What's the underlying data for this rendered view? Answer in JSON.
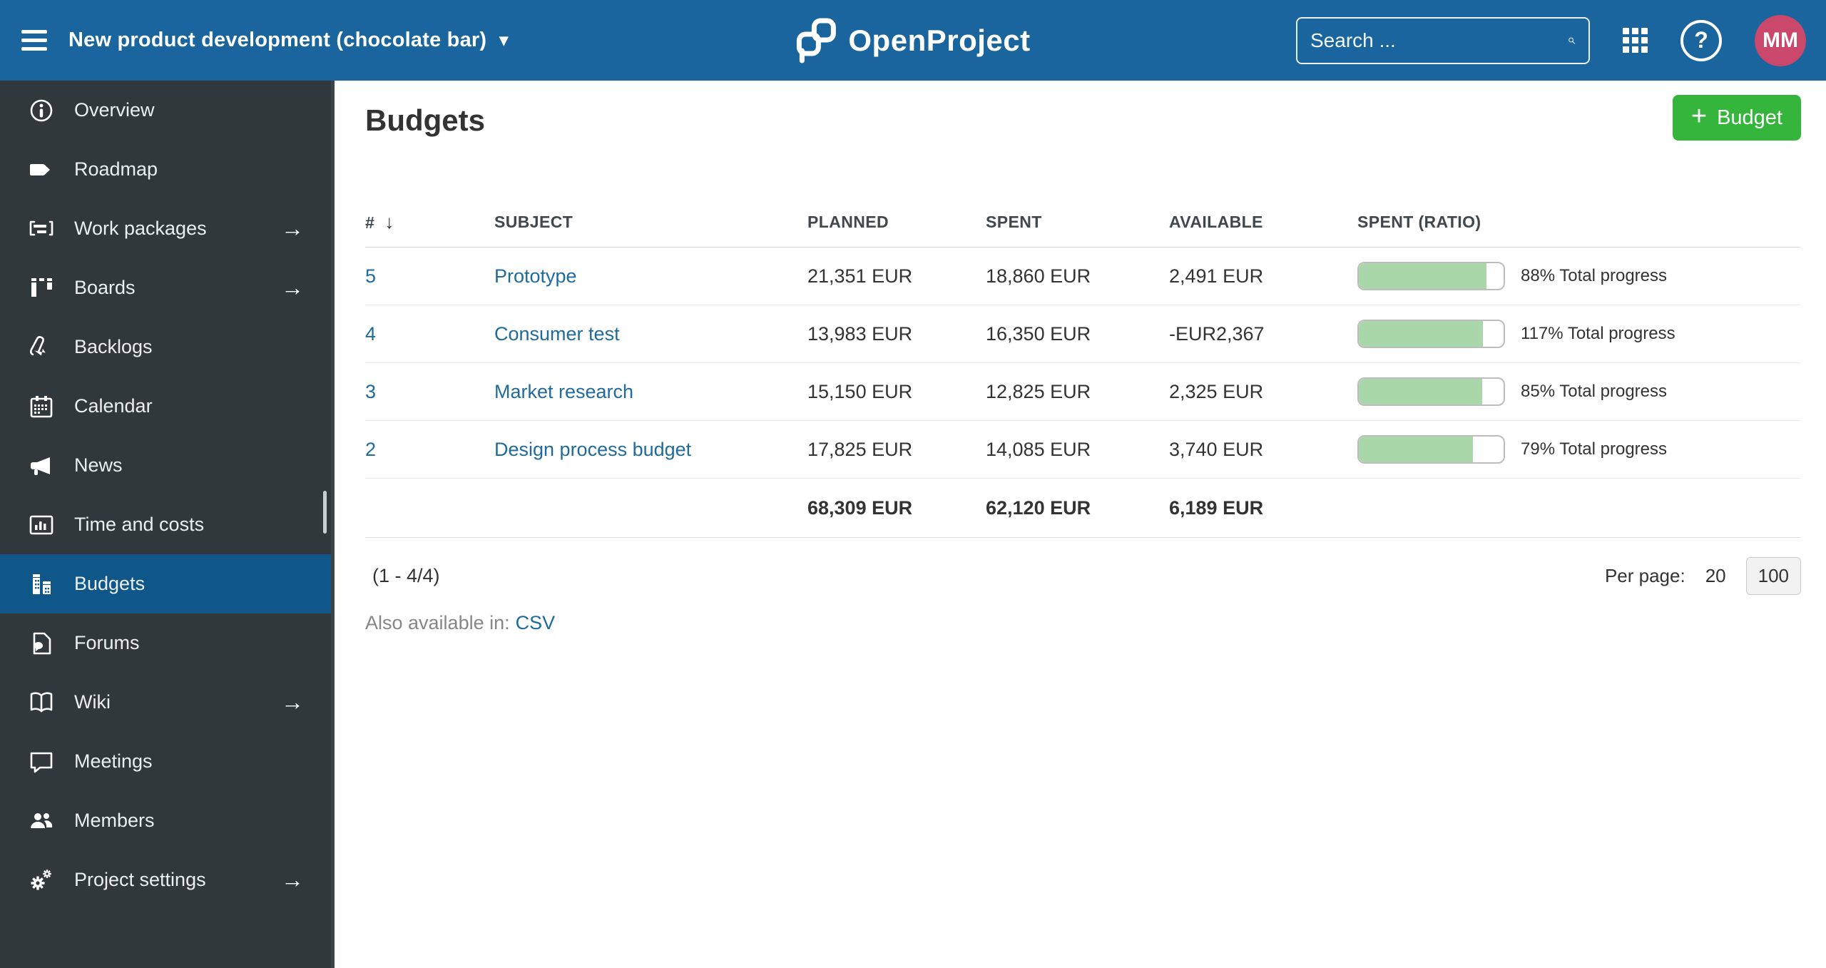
{
  "header": {
    "project_name": "New product development (chocolate bar)",
    "logo_text": "OpenProject",
    "search_placeholder": "Search ...",
    "avatar_initials": "MM"
  },
  "sidebar": {
    "items": [
      {
        "label": "Overview",
        "icon": "info-icon"
      },
      {
        "label": "Roadmap",
        "icon": "tag-icon"
      },
      {
        "label": "Work packages",
        "icon": "view-list-icon",
        "arrow": "→"
      },
      {
        "label": "Boards",
        "icon": "kanban-icon",
        "arrow": "→"
      },
      {
        "label": "Backlogs",
        "icon": "backlogs-icon"
      },
      {
        "label": "Calendar",
        "icon": "calendar-icon"
      },
      {
        "label": "News",
        "icon": "megaphone-icon"
      },
      {
        "label": "Time and costs",
        "icon": "chart-icon"
      },
      {
        "label": "Budgets",
        "icon": "budget-icon",
        "selected": true
      },
      {
        "label": "Forums",
        "icon": "forum-icon"
      },
      {
        "label": "Wiki",
        "icon": "book-icon",
        "arrow": "→"
      },
      {
        "label": "Meetings",
        "icon": "bubble-icon"
      },
      {
        "label": "Members",
        "icon": "people-icon"
      },
      {
        "label": "Project settings",
        "icon": "gears-icon",
        "arrow": "→"
      }
    ]
  },
  "main": {
    "title": "Budgets",
    "add_button": {
      "plus": "+",
      "label": "Budget"
    },
    "table": {
      "columns": {
        "id": "#",
        "sort_arrow": "↓",
        "subject": "SUBJECT",
        "planned": "PLANNED",
        "spent": "SPENT",
        "available": "AVAILABLE",
        "ratio": "SPENT (RATIO)"
      },
      "rows": [
        {
          "id": "5",
          "subject": "Prototype",
          "planned": "21,351 EUR",
          "spent": "18,860 EUR",
          "available": "2,491 EUR",
          "ratio_label": "88% Total progress",
          "bar_percent": 88
        },
        {
          "id": "4",
          "subject": "Consumer test",
          "planned": "13,983 EUR",
          "spent": "16,350 EUR",
          "available": "-EUR2,367",
          "ratio_label": "117% Total progress",
          "bar_percent": 85.5
        },
        {
          "id": "3",
          "subject": "Market research",
          "planned": "15,150 EUR",
          "spent": "12,825 EUR",
          "available": "2,325 EUR",
          "ratio_label": "85% Total progress",
          "bar_percent": 85
        },
        {
          "id": "2",
          "subject": "Design process budget",
          "planned": "17,825 EUR",
          "spent": "14,085 EUR",
          "available": "3,740 EUR",
          "ratio_label": "79% Total progress",
          "bar_percent": 79
        }
      ],
      "totals": {
        "planned": "68,309 EUR",
        "spent": "62,120 EUR",
        "available": "6,189 EUR"
      }
    },
    "pagination": {
      "range_label": "(1 - 4/4)",
      "per_page_label": "Per page:",
      "option_20": "20",
      "option_100": "100"
    },
    "export": {
      "prefix": "Also available in:",
      "csv": "CSV"
    }
  },
  "colors": {
    "header_blue": "#1A659D",
    "sidebar_bg": "#30383B",
    "selected_item_blue": "#0F5689",
    "button_green": "#35B53C",
    "link_blue": "#1F6B9E",
    "progress_green": "#A9D7A9",
    "avatar_pink": "#C9486B"
  }
}
